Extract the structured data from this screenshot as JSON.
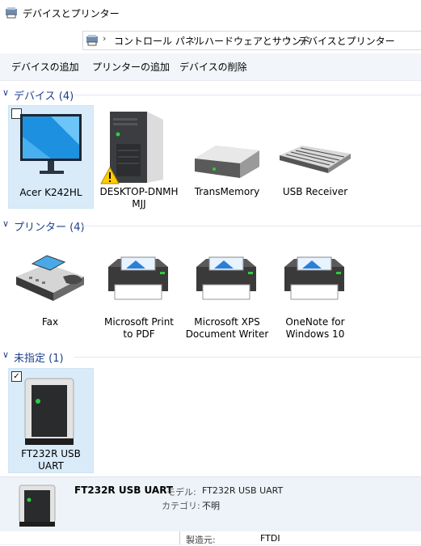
{
  "window": {
    "title": "デバイスとプリンター"
  },
  "address": {
    "crumbs": [
      "コントロール パネル",
      "ハードウェアとサウンド",
      "デバイスとプリンター"
    ]
  },
  "toolbar": {
    "add_device": "デバイスの追加",
    "add_printer": "プリンターの追加",
    "remove_device": "デバイスの削除"
  },
  "groups": {
    "devices": {
      "title": "デバイス (4)"
    },
    "printers": {
      "title": "プリンター (4)"
    },
    "unspecified": {
      "title": "未指定 (1)"
    }
  },
  "devices": [
    {
      "label": "Acer K242HL",
      "icon": "monitor-icon",
      "selected": true
    },
    {
      "label": "DESKTOP-DNMH\nMJJ",
      "icon": "computer-tower-icon",
      "warning": true
    },
    {
      "label": "TransMemory",
      "icon": "usb-drive-icon"
    },
    {
      "label": "USB Receiver",
      "icon": "keyboard-icon"
    }
  ],
  "printers": [
    {
      "label": "Fax",
      "icon": "fax-icon"
    },
    {
      "label": "Microsoft Print\nto PDF",
      "icon": "printer-icon"
    },
    {
      "label": "Microsoft XPS\nDocument Writer",
      "icon": "printer-icon"
    },
    {
      "label": "OneNote for\nWindows 10",
      "icon": "printer-icon"
    }
  ],
  "unspecified": [
    {
      "label": "FT232R USB\nUART",
      "icon": "device-box-icon",
      "selected": true,
      "checked": true
    }
  ],
  "details": {
    "name": "FT232R USB UART",
    "model_label": "モデル:",
    "model_value": "FT232R USB UART",
    "category_label": "カテゴリ:",
    "category_value": "不明",
    "manufacturer_label": "製造元:",
    "manufacturer_value": "FTDI"
  },
  "colors": {
    "accent": "#1e3f8b",
    "selection": "#d9ebf9",
    "command_bar": "#f2f5f9"
  }
}
